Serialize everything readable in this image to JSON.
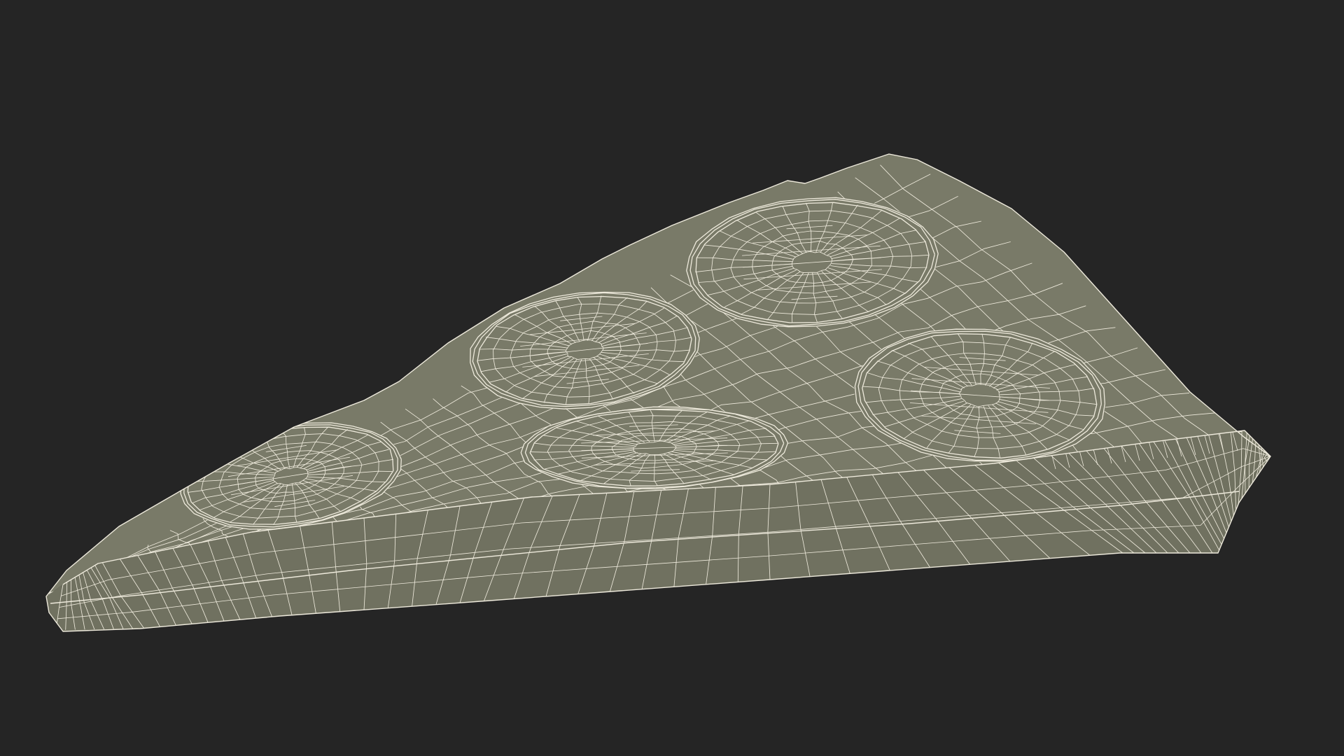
{
  "scene": {
    "object": "pepperoni-pizza-slice-wireframe",
    "render_mode": "wireframe-on-shaded",
    "pepperoni_count": 5
  },
  "colors": {
    "background": "#252525",
    "surface_top": "#797a68",
    "surface_side": "#707160",
    "surface_shadow": "#5f6052",
    "wire": "#eeeadc",
    "wire_dim": "#d9d5c6"
  }
}
